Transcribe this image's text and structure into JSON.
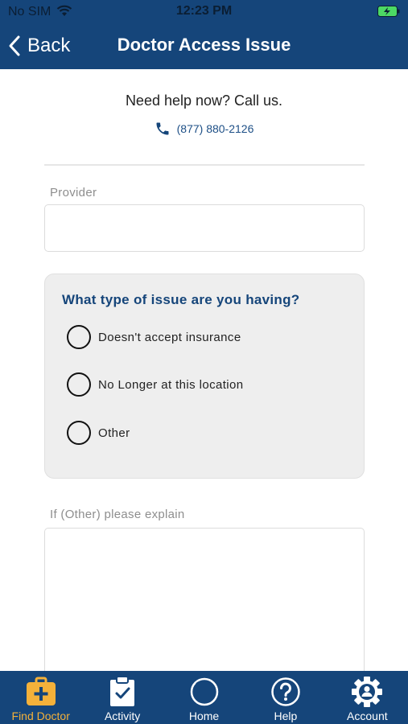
{
  "status_bar": {
    "carrier": "No SIM",
    "time": "12:23 PM"
  },
  "nav": {
    "back_label": "Back",
    "title": "Doctor Access Issue"
  },
  "help": {
    "text": "Need help now? Call us.",
    "phone": "(877) 880-2126"
  },
  "form": {
    "provider_label": "Provider",
    "provider_value": "",
    "issue_question": "What type of issue are you having?",
    "options": [
      {
        "label": "Doesn't accept insurance",
        "selected": false
      },
      {
        "label": "No Longer at this location",
        "selected": false
      },
      {
        "label": "Other",
        "selected": false
      }
    ],
    "explain_label": "If (Other) please explain",
    "explain_value": ""
  },
  "tabs": [
    {
      "label": "Find Doctor",
      "icon": "medical-kit-icon",
      "active": true
    },
    {
      "label": "Activity",
      "icon": "clipboard-check-icon",
      "active": false
    },
    {
      "label": "Home",
      "icon": "home-circle-icon",
      "active": false
    },
    {
      "label": "Help",
      "icon": "question-circle-icon",
      "active": false
    },
    {
      "label": "Account",
      "icon": "gear-person-icon",
      "active": false
    }
  ],
  "colors": {
    "brand": "#15457a",
    "accent": "#f4b13a",
    "link": "#1d4f86",
    "battery": "#4cd964"
  }
}
